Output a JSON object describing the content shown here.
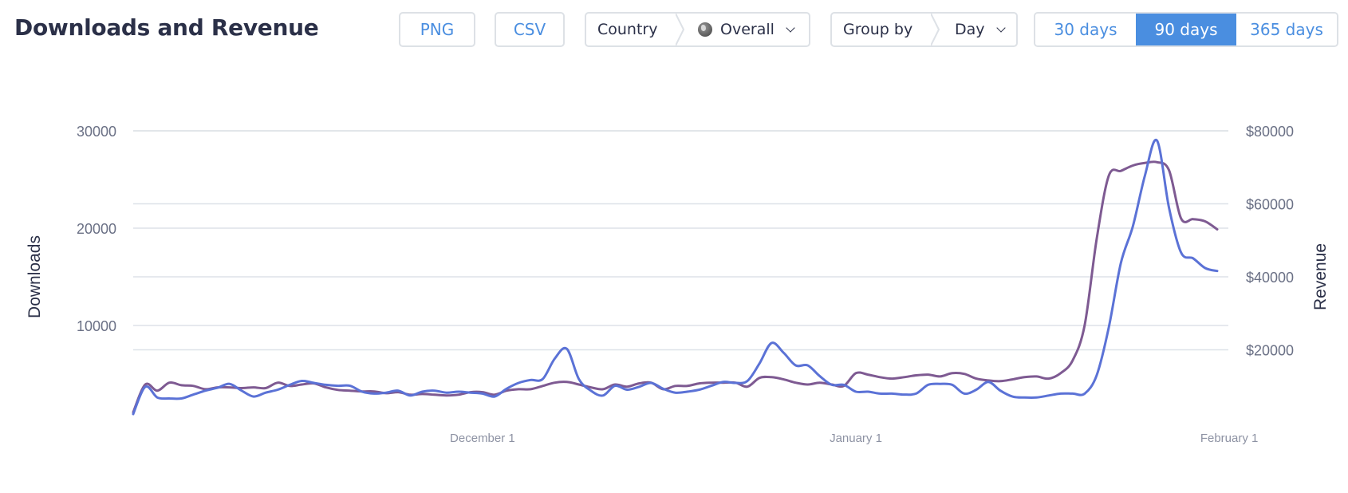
{
  "header": {
    "title": "Downloads and Revenue",
    "png_label": "PNG",
    "csv_label": "CSV",
    "country_label": "Country",
    "country_value": "Overall",
    "groupby_label": "Group by",
    "groupby_value": "Day",
    "ranges": [
      {
        "label": "30 days",
        "active": false
      },
      {
        "label": "90 days",
        "active": true
      },
      {
        "label": "365 days",
        "active": false
      }
    ],
    "accent_color": "#4a8ee0"
  },
  "chart_data": {
    "type": "line",
    "title": "Downloads and Revenue",
    "xlabel": "",
    "ylabel": "Downloads",
    "y2label": "Revenue",
    "x_start": "November 2",
    "x_end": "January 31",
    "x_ticks": [
      {
        "label": "December 1",
        "day_index": 29
      },
      {
        "label": "January 1",
        "day_index": 60
      },
      {
        "label": "February 1",
        "day_index": 91
      }
    ],
    "ylim": [
      0,
      30000
    ],
    "y_ticks": [
      "10000",
      "20000",
      "30000"
    ],
    "y2lim": [
      0,
      80000
    ],
    "y2_ticks": [
      "$20000",
      "$40000",
      "$60000",
      "$80000"
    ],
    "grid": true,
    "legend": "none",
    "series": [
      {
        "name": "Downloads",
        "axis": "left",
        "color": "#5b72d6",
        "values": [
          900,
          3700,
          2600,
          2500,
          2500,
          2900,
          3300,
          3600,
          4000,
          3300,
          2700,
          3100,
          3400,
          3900,
          4300,
          4100,
          3900,
          3800,
          3800,
          3200,
          3000,
          3100,
          3300,
          2800,
          3200,
          3300,
          3100,
          3200,
          3100,
          3000,
          2700,
          3500,
          4100,
          4400,
          4500,
          6600,
          7600,
          4500,
          3300,
          2800,
          3800,
          3400,
          3700,
          4100,
          3500,
          3100,
          3200,
          3400,
          3800,
          4200,
          4100,
          4300,
          6100,
          8200,
          7200,
          5900,
          5900,
          4800,
          3900,
          3900,
          3200,
          3200,
          3000,
          3000,
          2900,
          3000,
          3900,
          4000,
          3900,
          3000,
          3400,
          4200,
          3300,
          2700,
          2600,
          2600,
          2800,
          3000,
          3000,
          3000,
          4900,
          9800,
          16400,
          20200,
          25400,
          29000,
          22100,
          17500,
          16900,
          15900,
          15600
        ]
      },
      {
        "name": "Revenue",
        "axis": "right",
        "color": "#7e5a92",
        "values": [
          2900,
          10500,
          8800,
          11000,
          10300,
          10100,
          9200,
          9700,
          9700,
          9500,
          9700,
          9500,
          11000,
          10100,
          10500,
          10800,
          9700,
          9000,
          8800,
          8600,
          8600,
          8100,
          8400,
          7700,
          7900,
          7700,
          7500,
          7700,
          8400,
          8400,
          7700,
          8800,
          9200,
          9200,
          10100,
          11000,
          11200,
          10500,
          9700,
          9200,
          10500,
          9900,
          10800,
          11000,
          9200,
          10100,
          10100,
          10800,
          11000,
          11000,
          11000,
          9900,
          12300,
          12500,
          11900,
          11000,
          10500,
          11000,
          10500,
          10100,
          13600,
          13200,
          12500,
          12100,
          12500,
          13000,
          13200,
          12700,
          13600,
          13400,
          12100,
          11600,
          11400,
          11900,
          12500,
          12700,
          12100,
          13600,
          17100,
          26800,
          50500,
          67700,
          69000,
          70500,
          71200,
          71400,
          69200,
          56000,
          55800,
          55200,
          53000
        ]
      }
    ]
  }
}
